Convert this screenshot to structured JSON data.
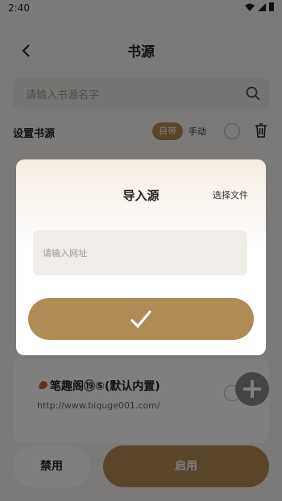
{
  "status_bar": {
    "time": "2:40"
  },
  "header": {
    "title": "书源"
  },
  "search": {
    "placeholder": "请输入书源名字"
  },
  "settings": {
    "label": "设置书源",
    "seg_builtin": "自带",
    "seg_manual": "手动"
  },
  "source_item": {
    "title": "笔趣阁⑲⑤(默认内置)",
    "url": "http://www.biquge001.com/"
  },
  "footer": {
    "disable_label": "禁用",
    "enable_label": "启用"
  },
  "dialog": {
    "title": "导入源",
    "select_file": "选择文件",
    "url_placeholder": "请输入网址"
  },
  "colors": {
    "accent": "#b08b55",
    "overlay": "rgba(0,0,0,0.5)"
  },
  "icons": [
    "back-arrow-icon",
    "search-icon",
    "trash-icon",
    "leaf-icon",
    "plus-icon",
    "check-icon",
    "wifi-icon",
    "signal-icon",
    "battery-icon"
  ]
}
